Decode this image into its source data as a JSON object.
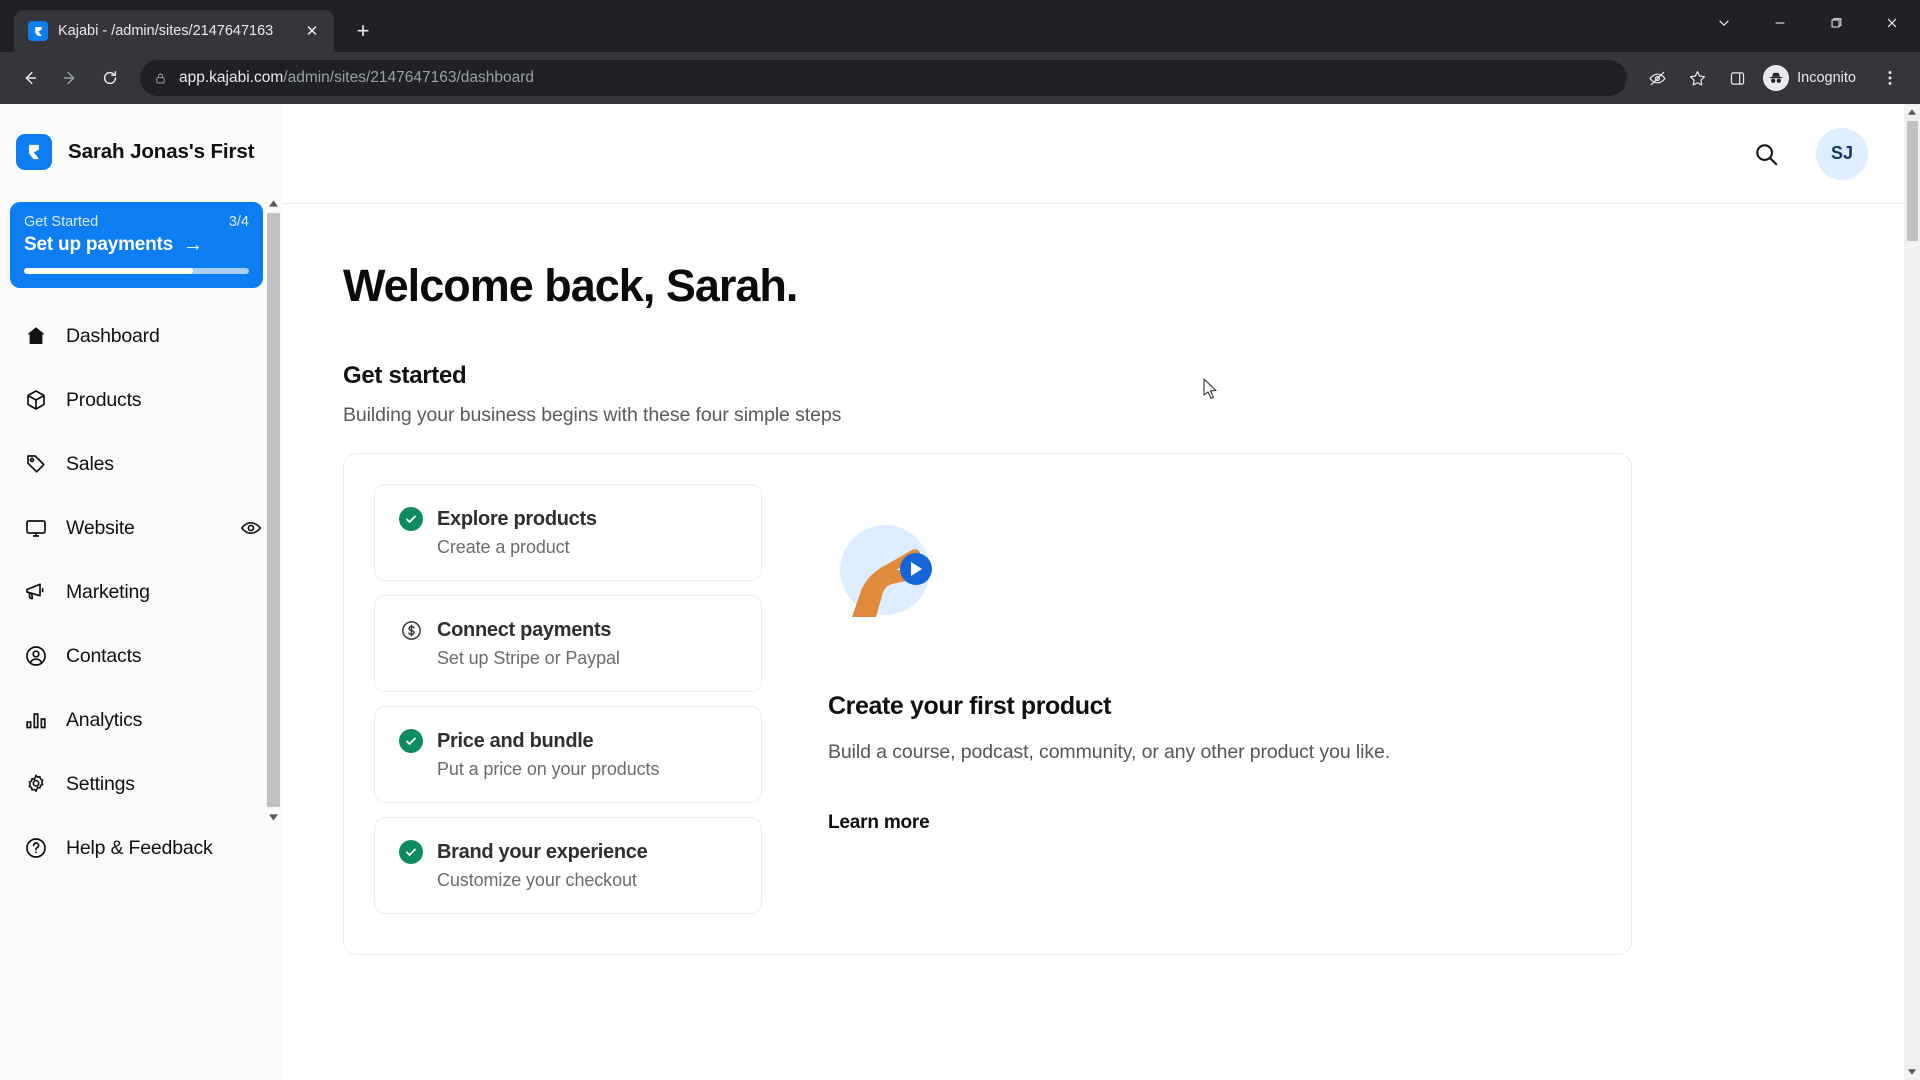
{
  "browser": {
    "tab": {
      "title": "Kajabi - /admin/sites/2147647163",
      "favicon": "kajabi-logo-icon",
      "close": "✕"
    },
    "new_tab_label": "+",
    "window_controls": {
      "minimize": "–",
      "maximize": "❐",
      "close": "✕",
      "tab_search": "⌄"
    },
    "nav": {
      "back": "←",
      "forward": "→",
      "reload": "↻"
    },
    "url_host": "app.kajabi.com",
    "url_path": "/admin/sites/2147647163/dashboard",
    "profile_label": "Incognito",
    "icons": {
      "lock": "lock-icon",
      "tracking_blocked": "eye-slash-icon",
      "bookmark": "star-icon",
      "side_panel": "side-panel-icon",
      "menu": "three-dot-menu-icon"
    }
  },
  "sidebar": {
    "brand_name": "Sarah Jonas's First",
    "get_started": {
      "label": "Get Started",
      "counter": "3/4",
      "action": "Set up payments",
      "arrow": "→",
      "progress_percent": 75
    },
    "items": [
      {
        "label": "Dashboard",
        "icon": "home-icon"
      },
      {
        "label": "Products",
        "icon": "cube-icon"
      },
      {
        "label": "Sales",
        "icon": "tag-icon"
      },
      {
        "label": "Website",
        "icon": "monitor-icon",
        "trailing_icon": "eye-icon"
      },
      {
        "label": "Marketing",
        "icon": "megaphone-icon"
      },
      {
        "label": "Contacts",
        "icon": "user-circle-icon"
      },
      {
        "label": "Analytics",
        "icon": "bar-chart-icon"
      },
      {
        "label": "Settings",
        "icon": "gear-icon"
      },
      {
        "label": "Help & Feedback",
        "icon": "question-circle-icon"
      }
    ]
  },
  "topbar": {
    "search_icon": "search-icon",
    "avatar_initials": "SJ"
  },
  "main": {
    "welcome": "Welcome back, Sarah.",
    "section_title": "Get started",
    "section_subtitle": "Building your business begins with these four simple steps",
    "steps": [
      {
        "title": "Explore products",
        "subtitle": "Create a product",
        "status": "complete",
        "icon": "check-circle-icon"
      },
      {
        "title": "Connect payments",
        "subtitle": "Set up Stripe or Paypal",
        "status": "incomplete",
        "icon": "dollar-circle-icon"
      },
      {
        "title": "Price and bundle",
        "subtitle": "Put a price on your products",
        "status": "complete",
        "icon": "check-circle-icon"
      },
      {
        "title": "Brand your experience",
        "subtitle": "Customize your checkout",
        "status": "complete",
        "icon": "check-circle-icon"
      }
    ],
    "promo": {
      "illustration": "hand-holding-play-button-icon",
      "heading": "Create your first product",
      "body": "Build a course, podcast, community, or any other product you like.",
      "link": "Learn more"
    }
  },
  "colors": {
    "brand_blue": "#0d7df2",
    "success_green": "#0f8b63",
    "avatar_bg": "#dceeff",
    "avatar_text": "#17356b"
  }
}
